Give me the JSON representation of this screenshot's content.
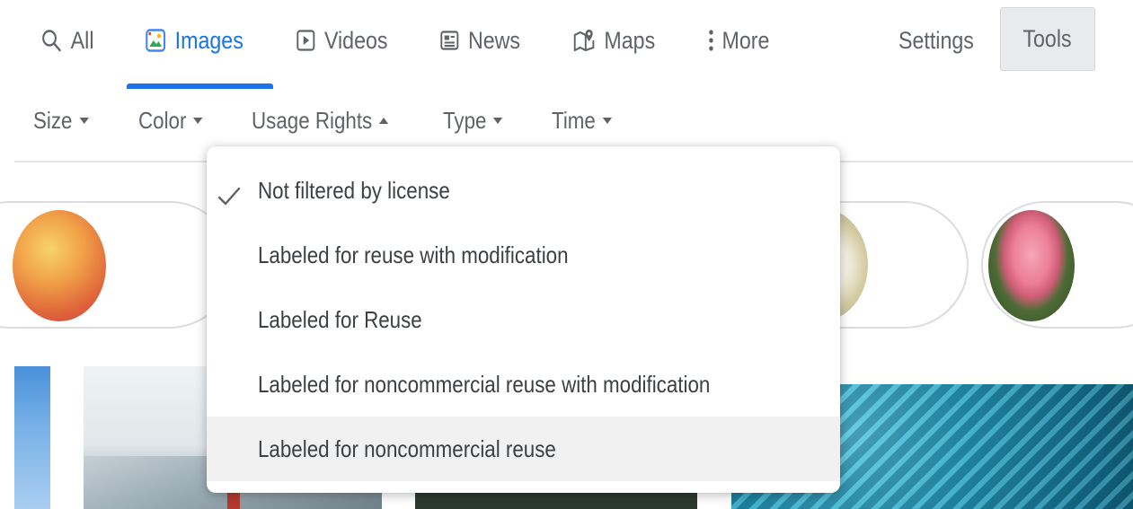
{
  "tabs": [
    {
      "label": "All",
      "icon": "search-icon",
      "active": false
    },
    {
      "label": "Images",
      "icon": "image-icon",
      "active": true
    },
    {
      "label": "Videos",
      "icon": "play-box-icon",
      "active": false
    },
    {
      "label": "News",
      "icon": "news-icon",
      "active": false
    },
    {
      "label": "Maps",
      "icon": "map-pin-icon",
      "active": false
    },
    {
      "label": "More",
      "icon": "vertical-dots-icon",
      "active": false
    }
  ],
  "settings_label": "Settings",
  "tools_label": "Tools",
  "filters": [
    {
      "label": "Size",
      "open": false
    },
    {
      "label": "Color",
      "open": false
    },
    {
      "label": "Usage Rights",
      "open": true
    },
    {
      "label": "Type",
      "open": false
    },
    {
      "label": "Time",
      "open": false
    }
  ],
  "usage_rights_menu": {
    "items": [
      {
        "label": "Not filtered by license",
        "checked": true,
        "highlighted": false
      },
      {
        "label": "Labeled for reuse with modification",
        "checked": false,
        "highlighted": false
      },
      {
        "label": "Labeled for Reuse",
        "checked": false,
        "highlighted": false
      },
      {
        "label": "Labeled for noncommercial reuse with modification",
        "checked": false,
        "highlighted": false
      },
      {
        "label": "Labeled for noncommercial reuse",
        "checked": false,
        "highlighted": true
      }
    ]
  },
  "colors": {
    "accent": "#1a73e8",
    "text": "#5f6368",
    "menu_text": "#3c4043",
    "tools_bg": "#e8eaed",
    "highlight_bg": "#f1f1f1"
  }
}
